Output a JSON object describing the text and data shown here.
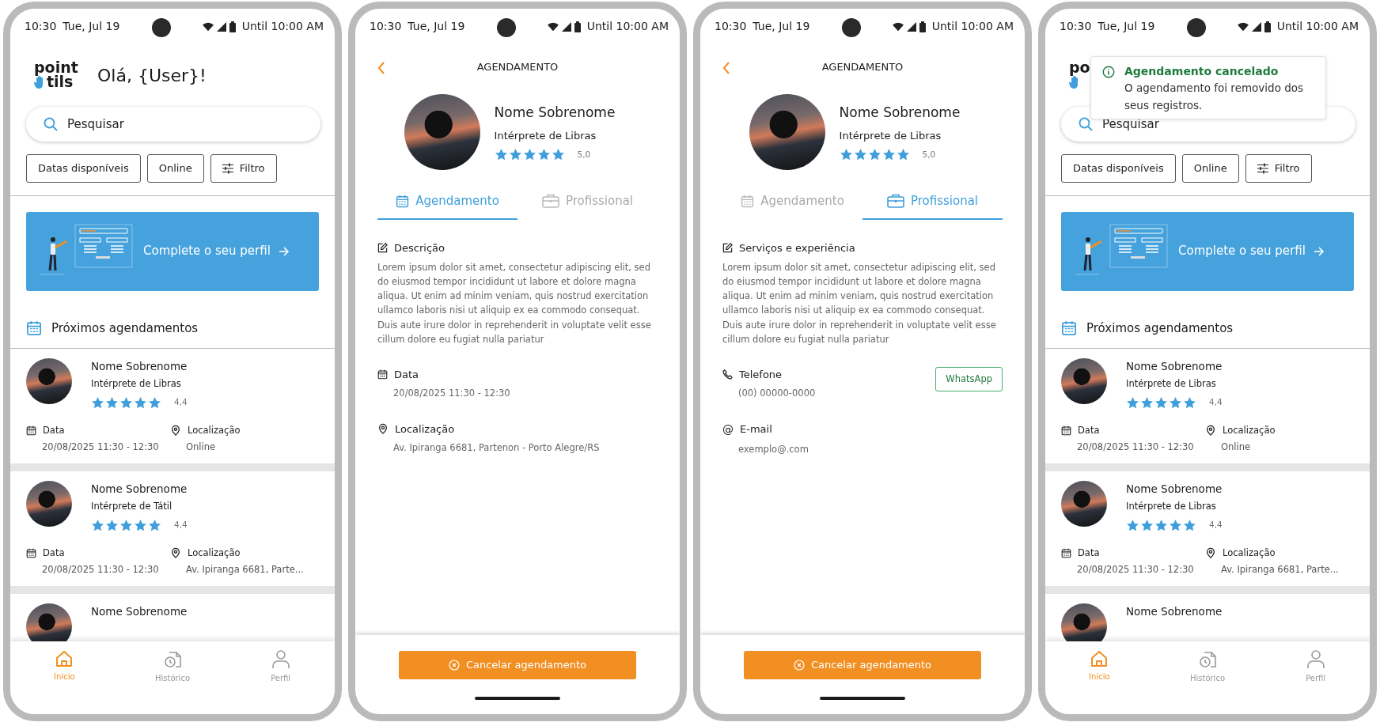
{
  "screens": [
    {
      "kind": "home",
      "status_bar": {
        "time": "10:30",
        "date": "Tue, Jul 19",
        "right": "Until 10:00 AM"
      },
      "logo": {
        "top": "point",
        "bottom": "tils"
      },
      "greeting": "Olá, {User}!",
      "search": {
        "placeholder": "Pesquisar"
      },
      "filters": [
        {
          "label": "Datas disponíveis",
          "kind": "plain"
        },
        {
          "label": "Online",
          "kind": "plain"
        },
        {
          "label": "Filtro",
          "kind": "filter"
        }
      ],
      "banner": {
        "text": "Complete o seu perfil"
      },
      "section_title": "Próximos agendamentos",
      "appointments": [
        {
          "name": "Nome Sobrenome",
          "role": "Intérprete de Libras",
          "stars": 5,
          "rating": "4,4",
          "date_label": "Data",
          "date": "20/08/2025 11:30 - 12:30",
          "location_label": "Localização",
          "location": "Online"
        },
        {
          "name": "Nome Sobrenome",
          "role": "Intérprete de Tátil",
          "stars": 5,
          "rating": "4,4",
          "date_label": "Data",
          "date": "20/08/2025 11:30 - 12:30",
          "location_label": "Localização",
          "location": "Av. Ipiranga 6681, Parte..."
        },
        {
          "name": "Nome Sobrenome"
        }
      ],
      "nav": [
        {
          "label": "Inicio",
          "selected": true
        },
        {
          "label": "Histórico",
          "selected": false
        },
        {
          "label": "Perfil",
          "selected": false
        }
      ]
    },
    {
      "kind": "detail",
      "status_bar": {
        "time": "10:30",
        "date": "Tue, Jul 19",
        "right": "Until 10:00 AM"
      },
      "title": "AGENDAMENTO",
      "profile": {
        "name": "Nome Sobrenome",
        "role": "Intérprete de Libras",
        "stars": 5,
        "rating": "5,0"
      },
      "tabs": [
        {
          "label": "Agendamento",
          "selected": true
        },
        {
          "label": "Profissional",
          "selected": false
        }
      ],
      "sections": [
        {
          "kind": "description",
          "title": "Descrição",
          "body": "Lorem ipsum dolor sit amet, consectetur adipiscing elit, sed do eiusmod tempor incididunt ut labore et dolore magna aliqua. Ut enim ad minim veniam, quis nostrud exercitation ullamco laboris nisi ut aliquip ex ea commodo consequat. Duis aute irure dolor in reprehenderit in voluptate velit esse cillum dolore eu fugiat nulla pariatur"
        },
        {
          "kind": "date",
          "title": "Data",
          "body": "20/08/2025 11:30 - 12:30"
        },
        {
          "kind": "location",
          "title": "Localização",
          "body": "Av. Ipiranga 6681, Partenon - Porto Alegre/RS"
        }
      ],
      "action": "Cancelar agendamento"
    },
    {
      "kind": "detail",
      "status_bar": {
        "time": "10:30",
        "date": "Tue, Jul 19",
        "right": "Until 10:00 AM"
      },
      "title": "AGENDAMENTO",
      "profile": {
        "name": "Nome Sobrenome",
        "role": "Intérprete de Libras",
        "stars": 5,
        "rating": "5,0"
      },
      "tabs": [
        {
          "label": "Agendamento",
          "selected": false
        },
        {
          "label": "Profissional",
          "selected": true
        }
      ],
      "sections": [
        {
          "kind": "description",
          "title": "Serviços e experiência",
          "body": "Lorem ipsum dolor sit amet, consectetur adipiscing elit, sed do eiusmod tempor incididunt ut labore et dolore magna aliqua. Ut enim ad minim veniam, quis nostrud exercitation ullamco laboris nisi ut aliquip ex ea commodo consequat. Duis aute irure dolor in reprehenderit in voluptate velit esse cillum dolore eu fugiat nulla pariatur"
        },
        {
          "kind": "phone",
          "title": "Telefone",
          "body": "(00) 00000-0000",
          "button": "WhatsApp"
        },
        {
          "kind": "email",
          "icon": "@",
          "title": "E-mail",
          "body": "exemplo@.com"
        }
      ],
      "action": "Cancelar agendamento"
    },
    {
      "kind": "home",
      "status_bar": {
        "time": "10:30",
        "date": "Tue, Jul 19",
        "right": "Until 10:00 AM"
      },
      "logo": {
        "top": "po"
      },
      "toast": {
        "title": "Agendamento cancelado",
        "message": "O agendamento foi removido dos seus registros."
      },
      "search": {
        "placeholder": "Pesquisar"
      },
      "filters": [
        {
          "label": "Datas disponíveis",
          "kind": "plain"
        },
        {
          "label": "Online",
          "kind": "plain"
        },
        {
          "label": "Filtro",
          "kind": "filter"
        }
      ],
      "banner": {
        "text": "Complete o seu perfil"
      },
      "section_title": "Próximos agendamentos",
      "appointments": [
        {
          "name": "Nome Sobrenome",
          "role": "Intérprete de Libras",
          "stars": 5,
          "rating": "4,4",
          "date_label": "Data",
          "date": "20/08/2025 11:30 - 12:30",
          "location_label": "Localização",
          "location": "Online"
        },
        {
          "name": "Nome Sobrenome",
          "role": "Intérprete de Libras",
          "stars": 5,
          "rating": "4,4",
          "date_label": "Data",
          "date": "20/08/2025 11:30 - 12:30",
          "location_label": "Localização",
          "location": "Av. Ipiranga 6681, Parte..."
        },
        {
          "name": "Nome Sobrenome"
        }
      ],
      "nav": [
        {
          "label": "Inicio",
          "selected": true
        },
        {
          "label": "Histórico",
          "selected": false
        },
        {
          "label": "Perfil",
          "selected": false
        }
      ]
    }
  ]
}
